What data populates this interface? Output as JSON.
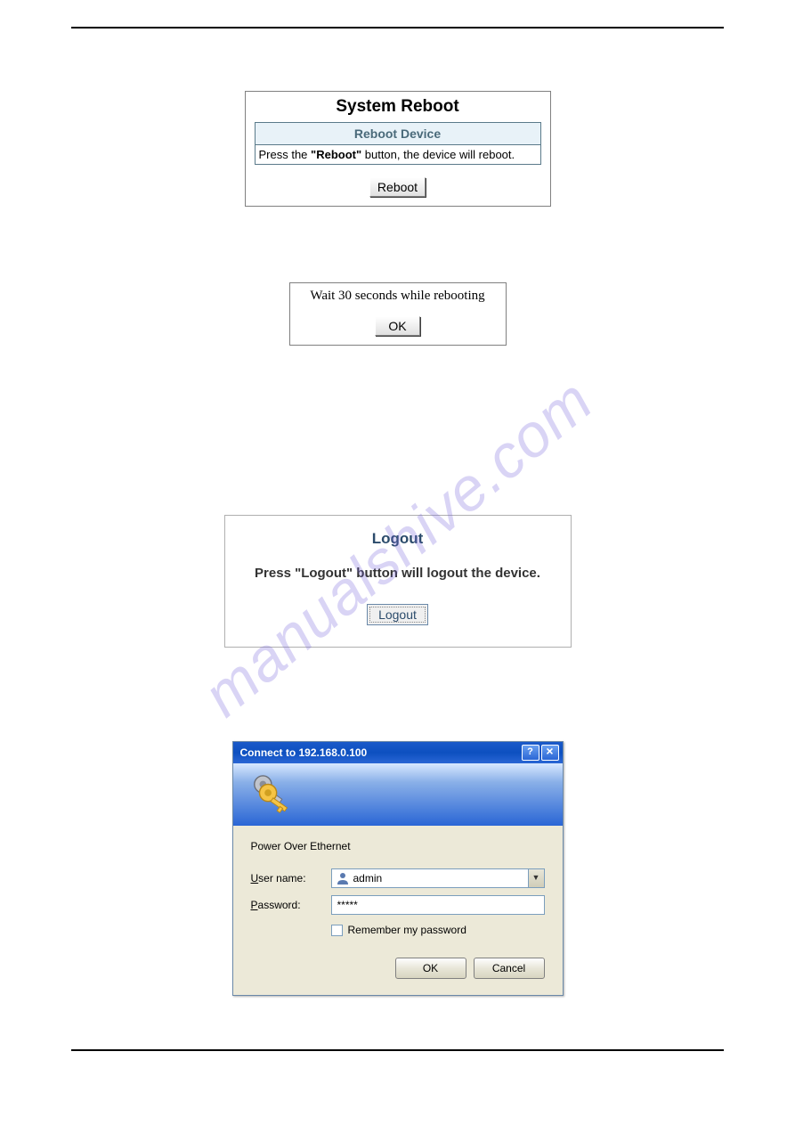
{
  "reboot": {
    "title": "System Reboot",
    "header": "Reboot Device",
    "text_pre": "Press the ",
    "text_bold": "\"Reboot\"",
    "text_post": " button, the device will reboot.",
    "button": "Reboot"
  },
  "wait": {
    "text": "Wait 30 seconds while rebooting",
    "button": "OK"
  },
  "logout": {
    "title": "Logout",
    "text": "Press \"Logout\" button will logout the device.",
    "button": "Logout"
  },
  "connect": {
    "title": "Connect to 192.168.0.100",
    "help_btn": "?",
    "close_btn": "×",
    "realm": "Power Over  Ethernet",
    "username_label_u": "U",
    "username_label_rest": "ser name:",
    "username_value": "admin",
    "password_label_u": "P",
    "password_label_rest": "assword:",
    "password_value": "*****",
    "remember_u": "R",
    "remember_rest": "emember my password",
    "ok": "OK",
    "cancel": "Cancel"
  },
  "watermark": "manualshive.com"
}
